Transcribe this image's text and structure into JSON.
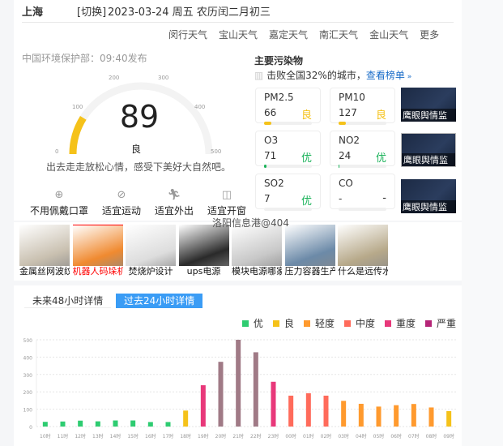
{
  "header": {
    "city": "上海",
    "switch_label": "[切换]",
    "date_line": "2023-03-24 周五 农历闰二月初三"
  },
  "districts": [
    "闵行天气",
    "宝山天气",
    "嘉定天气",
    "南汇天气",
    "金山天气",
    "更多"
  ],
  "publish": "中国环境保护部：09:40发布",
  "gauge": {
    "value": "89",
    "level": "良",
    "ticks": [
      "0",
      "100",
      "200",
      "300",
      "400",
      "500"
    ],
    "max": 500,
    "color": "#f5c21a",
    "advice": "出去走走放松心情，感受下美好大自然吧。"
  },
  "pollutants": {
    "title": "主要污染物",
    "rank_text": "击败全国32%的城市，",
    "rank_link": "查看榜单",
    "items": [
      {
        "name": "PM2.5",
        "value": "66",
        "level": "良",
        "color": "#f5c21a",
        "fill": 0.15
      },
      {
        "name": "PM10",
        "value": "127",
        "level": "良",
        "color": "#f5c21a",
        "fill": 0.15
      },
      {
        "name": "O3",
        "value": "71",
        "level": "优",
        "color": "#1bb35a",
        "fill": 0.05
      },
      {
        "name": "NO2",
        "value": "24",
        "level": "优",
        "color": "#1bb35a",
        "fill": 0.02
      },
      {
        "name": "SO2",
        "value": "7",
        "level": "优",
        "color": "#1bb35a",
        "fill": 0
      },
      {
        "name": "CO",
        "value": "-",
        "level": "-",
        "color": "#333333",
        "fill": 0
      }
    ],
    "ads": [
      "鹰眼舆情监",
      "鹰眼舆情监",
      "鹰眼舆情监"
    ]
  },
  "advice_items": [
    {
      "icon": "mask-icon",
      "label": "不用佩戴口罩"
    },
    {
      "icon": "ball-icon",
      "label": "适宜运动"
    },
    {
      "icon": "running-icon",
      "label": "适宜外出"
    },
    {
      "icon": "window-icon",
      "label": "适宜开窗"
    }
  ],
  "overlay_text": "洛阳信息港@404",
  "image_ads": [
    "金属丝网波纹",
    "机器人码垛机",
    "焚烧炉设计",
    "ups电源",
    "模块电源哪家",
    "压力容器生产",
    "什么是远传水"
  ],
  "tabs": [
    "未来48小时详情",
    "过去24小时详情"
  ],
  "legend": [
    {
      "label": "优",
      "color": "#2ecc71"
    },
    {
      "label": "良",
      "color": "#f5c21a"
    },
    {
      "label": "轻度",
      "color": "#ff9a2e"
    },
    {
      "label": "中度",
      "color": "#ff6b5b"
    },
    {
      "label": "重度",
      "color": "#e8387a"
    },
    {
      "label": "严重",
      "color": "#b52577"
    }
  ],
  "chart_data": {
    "type": "bar",
    "categories": [
      "10时",
      "11时",
      "12时",
      "13时",
      "14时",
      "15时",
      "16时",
      "17时",
      "18时",
      "19时",
      "20时",
      "21时",
      "22时",
      "23时",
      "00时",
      "01时",
      "02时",
      "03时",
      "04时",
      "05时",
      "06时",
      "07时",
      "08时",
      "09时"
    ],
    "values": [
      27,
      29,
      34,
      30,
      35,
      35,
      26,
      26,
      92,
      238,
      373,
      500,
      428,
      258,
      178,
      192,
      178,
      148,
      131,
      115,
      123,
      130,
      110,
      89
    ],
    "yticks": [
      "0",
      "100",
      "200",
      "300",
      "400",
      "500"
    ],
    "ylim": [
      0,
      500
    ],
    "grid": true
  }
}
